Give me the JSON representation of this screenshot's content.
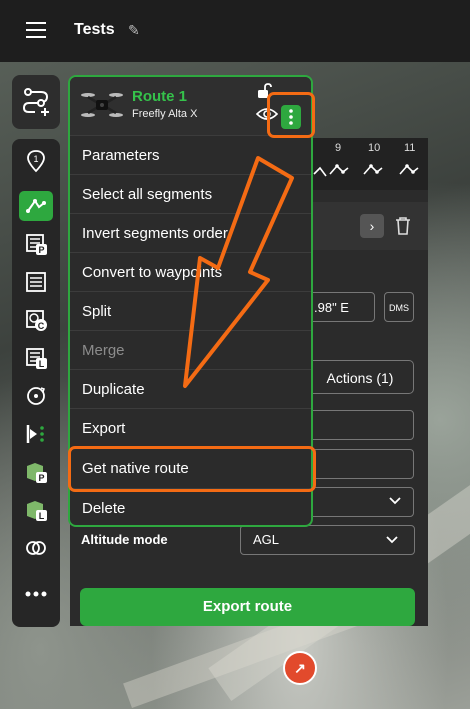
{
  "header": {
    "title": "Tests"
  },
  "route": {
    "name": "Route 1",
    "model": "Freefly Alta X"
  },
  "menu": {
    "items": [
      {
        "label": "Parameters"
      },
      {
        "label": "Select all segments"
      },
      {
        "label": "Invert segments order"
      },
      {
        "label": "Convert to waypoints"
      },
      {
        "label": "Split"
      },
      {
        "label": "Merge"
      },
      {
        "label": "Duplicate"
      },
      {
        "label": "Export"
      },
      {
        "label": "Get native route"
      },
      {
        "label": "Delete"
      }
    ]
  },
  "segments": {
    "numbers": [
      "9",
      "10",
      "11"
    ]
  },
  "panel": {
    "coordinate_value": ".98\" E",
    "coord_format_label": "DMS",
    "actions_tab_label": "Actions (1)",
    "altitude_mode_label": "Altitude mode",
    "altitude_mode_value": "AGL",
    "export_button_label": "Export route"
  },
  "colors": {
    "accent": "#2ea83f",
    "annotation": "#f46b14"
  }
}
